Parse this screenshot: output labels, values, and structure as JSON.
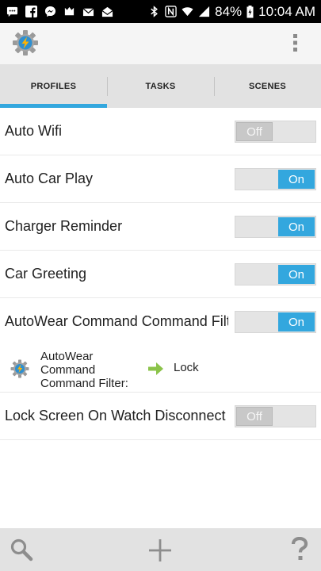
{
  "status_bar": {
    "battery": "84%",
    "time": "10:04 AM"
  },
  "app_bar": {
    "app_icon": "tasker-gear-icon",
    "menu_icon": "overflow-menu-icon"
  },
  "tabs": [
    {
      "label": "PROFILES",
      "active": true
    },
    {
      "label": "TASKS",
      "active": false
    },
    {
      "label": "SCENES",
      "active": false
    }
  ],
  "profiles": [
    {
      "name": "Auto Wifi",
      "toggle": "Off"
    },
    {
      "name": "Auto Car Play",
      "toggle": "On"
    },
    {
      "name": "Charger Reminder",
      "toggle": "On"
    },
    {
      "name": "Car Greeting",
      "toggle": "On"
    },
    {
      "name": "AutoWear Command Command Filter",
      "toggle": "On"
    },
    {
      "name": "Lock Screen On Watch Disconnect",
      "toggle": "Off"
    }
  ],
  "expanded_profile": {
    "context_label": "AutoWear Command Command Filter:",
    "task": "Lock"
  },
  "bottom_bar": {
    "search_icon": "search-icon",
    "add_icon": "plus-icon",
    "help_icon": "help-icon"
  },
  "colors": {
    "accent": "#33a7de",
    "arrow_green": "#8bc34a"
  }
}
